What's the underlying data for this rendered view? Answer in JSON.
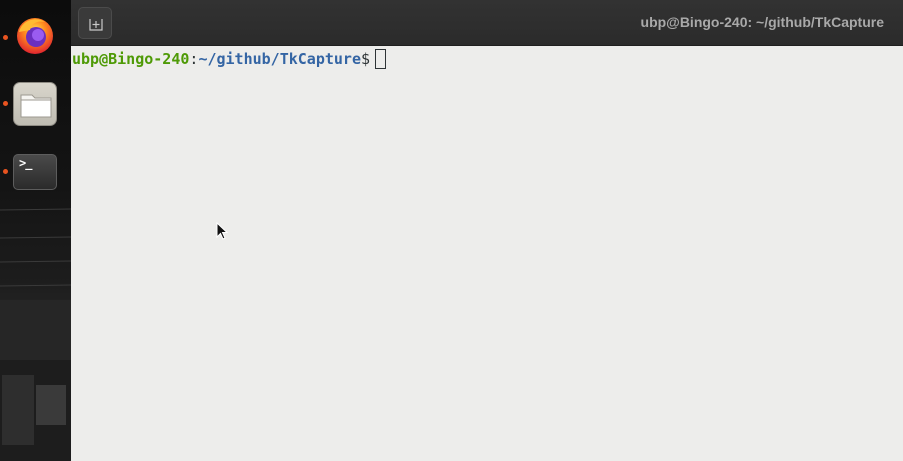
{
  "dock": {
    "apps": [
      {
        "name": "Firefox",
        "icon": "firefox-icon",
        "running": true
      },
      {
        "name": "Files",
        "icon": "folder-icon",
        "running": true
      },
      {
        "name": "Terminal",
        "icon": "terminal-icon",
        "running": true
      }
    ],
    "terminal_glyph": ">_"
  },
  "window": {
    "title": "ubp@Bingo-240: ~/github/TkCapture",
    "new_tab_icon": "new-tab-icon"
  },
  "terminal": {
    "prompt_user_host": "ubp@Bingo-240",
    "prompt_colon": ":",
    "prompt_path": "~/github/TkCapture",
    "prompt_symbol": "$",
    "input": ""
  },
  "colors": {
    "prompt_user": "#4e9a06",
    "prompt_path": "#3465a4",
    "terminal_bg": "#ededeb",
    "titlebar_bg": "#2c2c2c",
    "running_indicator": "#e95420"
  }
}
